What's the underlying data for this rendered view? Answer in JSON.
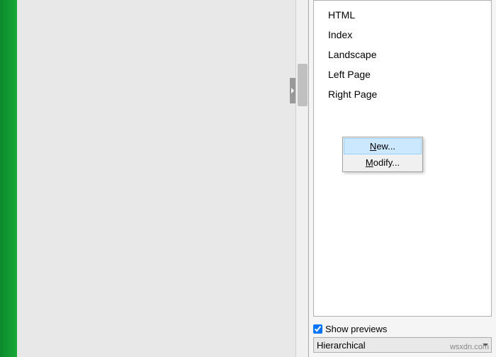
{
  "styles": {
    "items": [
      "HTML",
      "Index",
      "Landscape",
      "Left Page",
      "Right Page"
    ]
  },
  "context_menu": {
    "new": "New...",
    "modify": "Modify..."
  },
  "footer": {
    "show_previews_label": "Show previews",
    "view_mode": "Hierarchical"
  },
  "watermark": "wsxdn.com"
}
